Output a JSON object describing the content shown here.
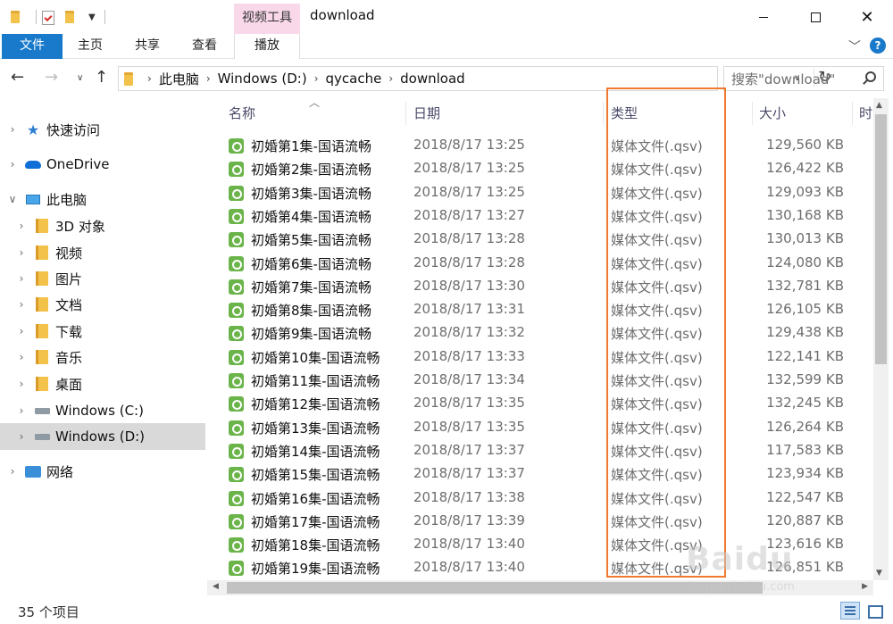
{
  "window": {
    "title": "download",
    "context_tab": "视频工具",
    "minimize": "—",
    "close": "✕"
  },
  "ribbon": {
    "tabs": {
      "file": "文件",
      "home": "主页",
      "share": "共享",
      "view": "查看",
      "play": "播放"
    },
    "help": "?"
  },
  "address": {
    "crumbs": [
      "此电脑",
      "Windows (D:)",
      "qycache",
      "download"
    ],
    "search_placeholder": "搜索\"download\""
  },
  "sidebar": {
    "items": [
      {
        "label": "快速访问",
        "icon": "star-icon",
        "expanded": false
      },
      {
        "label": "OneDrive",
        "icon": "cloud-icon",
        "expanded": false
      },
      {
        "label": "此电脑",
        "icon": "computer-icon",
        "expanded": true
      },
      {
        "label": "3D 对象",
        "icon": "3d-objects-icon"
      },
      {
        "label": "视频",
        "icon": "videos-icon"
      },
      {
        "label": "图片",
        "icon": "pictures-icon"
      },
      {
        "label": "文档",
        "icon": "documents-icon"
      },
      {
        "label": "下载",
        "icon": "downloads-icon"
      },
      {
        "label": "音乐",
        "icon": "music-icon"
      },
      {
        "label": "桌面",
        "icon": "desktop-icon"
      },
      {
        "label": "Windows (C:)",
        "icon": "drive-icon"
      },
      {
        "label": "Windows (D:)",
        "icon": "drive-icon",
        "selected": true
      },
      {
        "label": "网络",
        "icon": "network-icon",
        "expanded": false
      }
    ]
  },
  "columns": {
    "name": "名称",
    "date": "日期",
    "type": "类型",
    "size": "大小",
    "duration": "时"
  },
  "files": [
    {
      "name": "初婚第1集-国语流畅",
      "date": "2018/8/17 13:25",
      "type": "媒体文件(.qsv)",
      "size": "129,560 KB"
    },
    {
      "name": "初婚第2集-国语流畅",
      "date": "2018/8/17 13:25",
      "type": "媒体文件(.qsv)",
      "size": "126,422 KB"
    },
    {
      "name": "初婚第3集-国语流畅",
      "date": "2018/8/17 13:25",
      "type": "媒体文件(.qsv)",
      "size": "129,093 KB"
    },
    {
      "name": "初婚第4集-国语流畅",
      "date": "2018/8/17 13:27",
      "type": "媒体文件(.qsv)",
      "size": "130,168 KB"
    },
    {
      "name": "初婚第5集-国语流畅",
      "date": "2018/8/17 13:28",
      "type": "媒体文件(.qsv)",
      "size": "130,013 KB"
    },
    {
      "name": "初婚第6集-国语流畅",
      "date": "2018/8/17 13:28",
      "type": "媒体文件(.qsv)",
      "size": "124,080 KB"
    },
    {
      "name": "初婚第7集-国语流畅",
      "date": "2018/8/17 13:30",
      "type": "媒体文件(.qsv)",
      "size": "132,781 KB"
    },
    {
      "name": "初婚第8集-国语流畅",
      "date": "2018/8/17 13:31",
      "type": "媒体文件(.qsv)",
      "size": "126,105 KB"
    },
    {
      "name": "初婚第9集-国语流畅",
      "date": "2018/8/17 13:32",
      "type": "媒体文件(.qsv)",
      "size": "129,438 KB"
    },
    {
      "name": "初婚第10集-国语流畅",
      "date": "2018/8/17 13:33",
      "type": "媒体文件(.qsv)",
      "size": "122,141 KB"
    },
    {
      "name": "初婚第11集-国语流畅",
      "date": "2018/8/17 13:34",
      "type": "媒体文件(.qsv)",
      "size": "132,599 KB"
    },
    {
      "name": "初婚第12集-国语流畅",
      "date": "2018/8/17 13:35",
      "type": "媒体文件(.qsv)",
      "size": "132,245 KB"
    },
    {
      "name": "初婚第13集-国语流畅",
      "date": "2018/8/17 13:35",
      "type": "媒体文件(.qsv)",
      "size": "126,264 KB"
    },
    {
      "name": "初婚第14集-国语流畅",
      "date": "2018/8/17 13:37",
      "type": "媒体文件(.qsv)",
      "size": "117,583 KB"
    },
    {
      "name": "初婚第15集-国语流畅",
      "date": "2018/8/17 13:37",
      "type": "媒体文件(.qsv)",
      "size": "123,934 KB"
    },
    {
      "name": "初婚第16集-国语流畅",
      "date": "2018/8/17 13:38",
      "type": "媒体文件(.qsv)",
      "size": "122,547 KB"
    },
    {
      "name": "初婚第17集-国语流畅",
      "date": "2018/8/17 13:39",
      "type": "媒体文件(.qsv)",
      "size": "120,887 KB"
    },
    {
      "name": "初婚第18集-国语流畅",
      "date": "2018/8/17 13:40",
      "type": "媒体文件(.qsv)",
      "size": "123,616 KB"
    },
    {
      "name": "初婚第19集-国语流畅",
      "date": "2018/8/17 13:40",
      "type": "媒体文件(.qsv)",
      "size": "126,851 KB"
    }
  ],
  "status": {
    "item_count": "35 个项目"
  },
  "watermark": {
    "logo": "Baidu",
    "url": "jingyan.baidu.com"
  },
  "colors": {
    "accent": "#1979ca",
    "context_tab": "#f9d8ea",
    "highlight": "#ef7a2f",
    "file_icon": "#6ab44a"
  }
}
